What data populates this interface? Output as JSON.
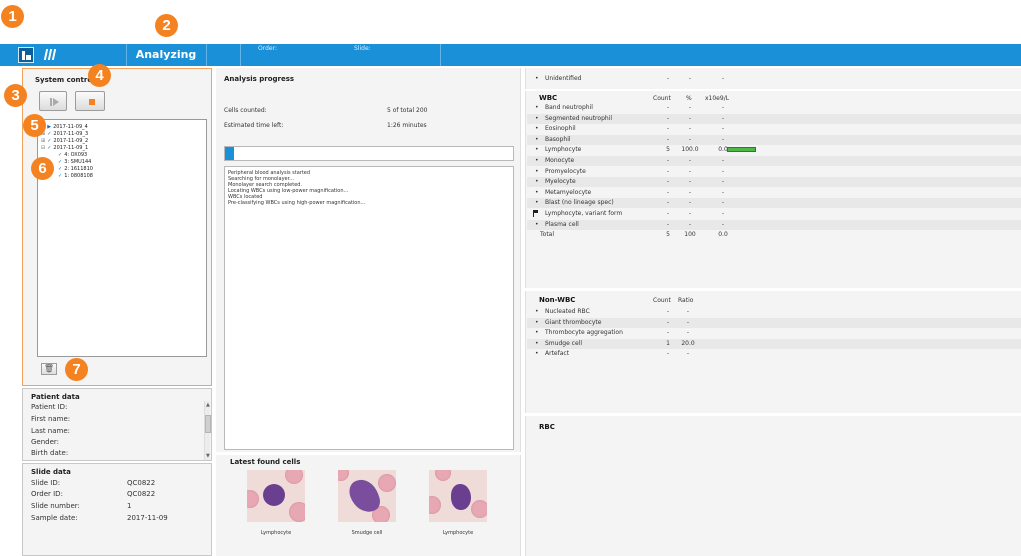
{
  "callouts": [
    "1",
    "2",
    "3",
    "4",
    "5",
    "6",
    "7"
  ],
  "topbar": {
    "status": "Analyzing",
    "order_label": "Order:",
    "slide_label": "Slide:",
    "home_icon": "home-icon",
    "slides_icon": "slides-icon"
  },
  "system_control": {
    "title": "System control",
    "tree": [
      {
        "expander": "⊞",
        "check": "▶",
        "label": "2017-11-09_4"
      },
      {
        "expander": "⊞",
        "check": "✓",
        "label": "2017-11-09_3"
      },
      {
        "expander": "⊞",
        "check": "✓",
        "label": "2017-11-09_2"
      },
      {
        "expander": "⊟",
        "check": "✓",
        "label": "2017-11-09_1"
      },
      {
        "expander": "",
        "check": "✓",
        "label": "4: OX093"
      },
      {
        "expander": "",
        "check": "✓",
        "label": "3: SMU144"
      },
      {
        "expander": "",
        "check": "✓",
        "label": "2: 1611810"
      },
      {
        "expander": "",
        "check": "✓",
        "label": "1: 0808108"
      }
    ],
    "trash_glyph": "🗑"
  },
  "patient_data": {
    "title": "Patient data",
    "fields": [
      "Patient ID:",
      "First name:",
      "Last name:",
      "Gender:",
      "Birth date:"
    ]
  },
  "slide_data": {
    "title": "Slide data",
    "fields": [
      {
        "label": "Slide ID:",
        "value": "QC0822"
      },
      {
        "label": "Order ID:",
        "value": "QC0822"
      },
      {
        "label": "Slide number:",
        "value": "1"
      },
      {
        "label": "Sample date:",
        "value": "2017-11-09"
      }
    ]
  },
  "analysis": {
    "title": "Analysis progress",
    "cells_counted_label": "Cells counted:",
    "cells_counted_value": "5 of total 200",
    "time_left_label": "Estimated time left:",
    "time_left_value": "1:26 minutes",
    "progress": 0.025,
    "log": [
      "Peripheral blood analysis started",
      "Searching for monolayer...",
      "Monolayer search completed.",
      "Locating WBCs using low-power magnification...",
      "WBCs located",
      "Pre-classifying WBCs using high-power magnification..."
    ]
  },
  "latest_cells": {
    "title": "Latest found cells",
    "cells": [
      "Lymphocyte",
      "Smudge cell",
      "Lymphocyte"
    ]
  },
  "unidentified": {
    "name": "Unidentified",
    "count": "-",
    "pct": "-",
    "abs": "-"
  },
  "wbc": {
    "title": "WBC",
    "col_count": "Count",
    "col_pct": "%",
    "col_abs": "x10e9/L",
    "rows": [
      {
        "name": "Band neutrophil",
        "count": "-",
        "pct": "-",
        "abs": "-"
      },
      {
        "name": "Segmented neutrophil",
        "count": "-",
        "pct": "-",
        "abs": "-"
      },
      {
        "name": "Eosinophil",
        "count": "-",
        "pct": "-",
        "abs": "-"
      },
      {
        "name": "Basophil",
        "count": "-",
        "pct": "-",
        "abs": "-"
      },
      {
        "name": "Lymphocyte",
        "count": "5",
        "pct": "100.0",
        "abs": "0.0"
      },
      {
        "name": "Monocyte",
        "count": "-",
        "pct": "-",
        "abs": "-"
      },
      {
        "name": "Promyelocyte",
        "count": "-",
        "pct": "-",
        "abs": "-"
      },
      {
        "name": "Myelocyte",
        "count": "-",
        "pct": "-",
        "abs": "-"
      },
      {
        "name": "Metamyelocyte",
        "count": "-",
        "pct": "-",
        "abs": "-"
      },
      {
        "name": "Blast (no lineage spec)",
        "count": "-",
        "pct": "-",
        "abs": "-"
      },
      {
        "name": "Lymphocyte, variant form",
        "count": "-",
        "pct": "-",
        "abs": "-"
      },
      {
        "name": "Plasma cell",
        "count": "-",
        "pct": "-",
        "abs": "-"
      }
    ],
    "total": {
      "name": "Total",
      "count": "5",
      "pct": "100",
      "abs": "0.0"
    },
    "lymphocyte_fraction": 1.0
  },
  "non_wbc": {
    "title": "Non-WBC",
    "col_count": "Count",
    "col_ratio": "Ratio",
    "rows": [
      {
        "name": "Nucleated RBC",
        "count": "-",
        "ratio": "-"
      },
      {
        "name": "Giant thrombocyte",
        "count": "-",
        "ratio": "-"
      },
      {
        "name": "Thrombocyte aggregation",
        "count": "-",
        "ratio": "-"
      },
      {
        "name": "Smudge cell",
        "count": "1",
        "ratio": "20.0"
      },
      {
        "name": "Artefact",
        "count": "-",
        "ratio": "-"
      }
    ]
  },
  "rbc": {
    "title": "RBC"
  },
  "colors": {
    "accent": "#1a90d8",
    "callout": "#f58220",
    "bar": "#4db848"
  }
}
